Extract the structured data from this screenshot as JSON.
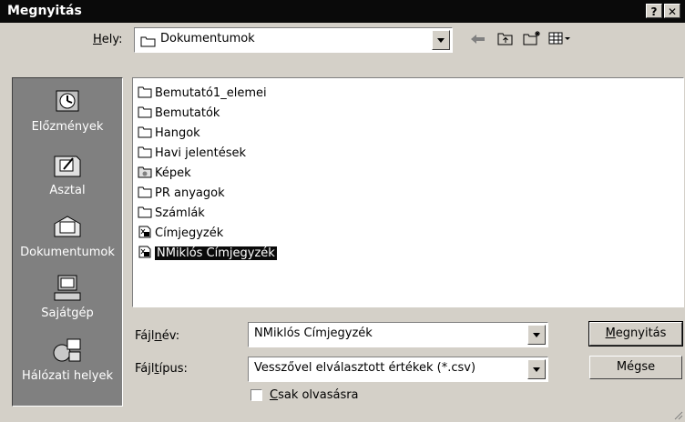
{
  "window": {
    "title": "Megnyitás",
    "help_label": "?",
    "close_label": "✕"
  },
  "location": {
    "label_prefix": "",
    "label_underline": "H",
    "label_rest": "ely:",
    "value": "Dokumentumok"
  },
  "places": [
    {
      "label": "Előzmények",
      "icon": "history-icon"
    },
    {
      "label": "Asztal",
      "icon": "desktop-icon"
    },
    {
      "label": "Dokumentumok",
      "icon": "documents-icon"
    },
    {
      "label": "Sajátgép",
      "icon": "my-computer-icon"
    },
    {
      "label": "Hálózati helyek",
      "icon": "network-places-icon"
    }
  ],
  "files": [
    {
      "name": "Bemutató1_elemei",
      "type": "folder"
    },
    {
      "name": "Bemutatók",
      "type": "folder"
    },
    {
      "name": "Hangok",
      "type": "folder"
    },
    {
      "name": "Havi jelentések",
      "type": "folder"
    },
    {
      "name": "Képek",
      "type": "image-folder"
    },
    {
      "name": "PR anyagok",
      "type": "folder"
    },
    {
      "name": "Számlák",
      "type": "folder"
    },
    {
      "name": "Címjegyzék",
      "type": "csv"
    },
    {
      "name": "NMiklós Címjegyzék",
      "type": "csv",
      "selected": true
    }
  ],
  "filename": {
    "label_a": "Fájl",
    "label_u": "n",
    "label_b": "év:",
    "value": "NMiklós Címjegyzék"
  },
  "filetype": {
    "label_a": "Fájl",
    "label_u": "t",
    "label_b": "ípus:",
    "value": "Vesszővel elválasztott értékek (*.csv)"
  },
  "readonly": {
    "label_u": "C",
    "label_rest": "sak olvasásra",
    "checked": false
  },
  "buttons": {
    "open_u": "M",
    "open_rest": "egnyitás",
    "cancel": "Mégse"
  }
}
